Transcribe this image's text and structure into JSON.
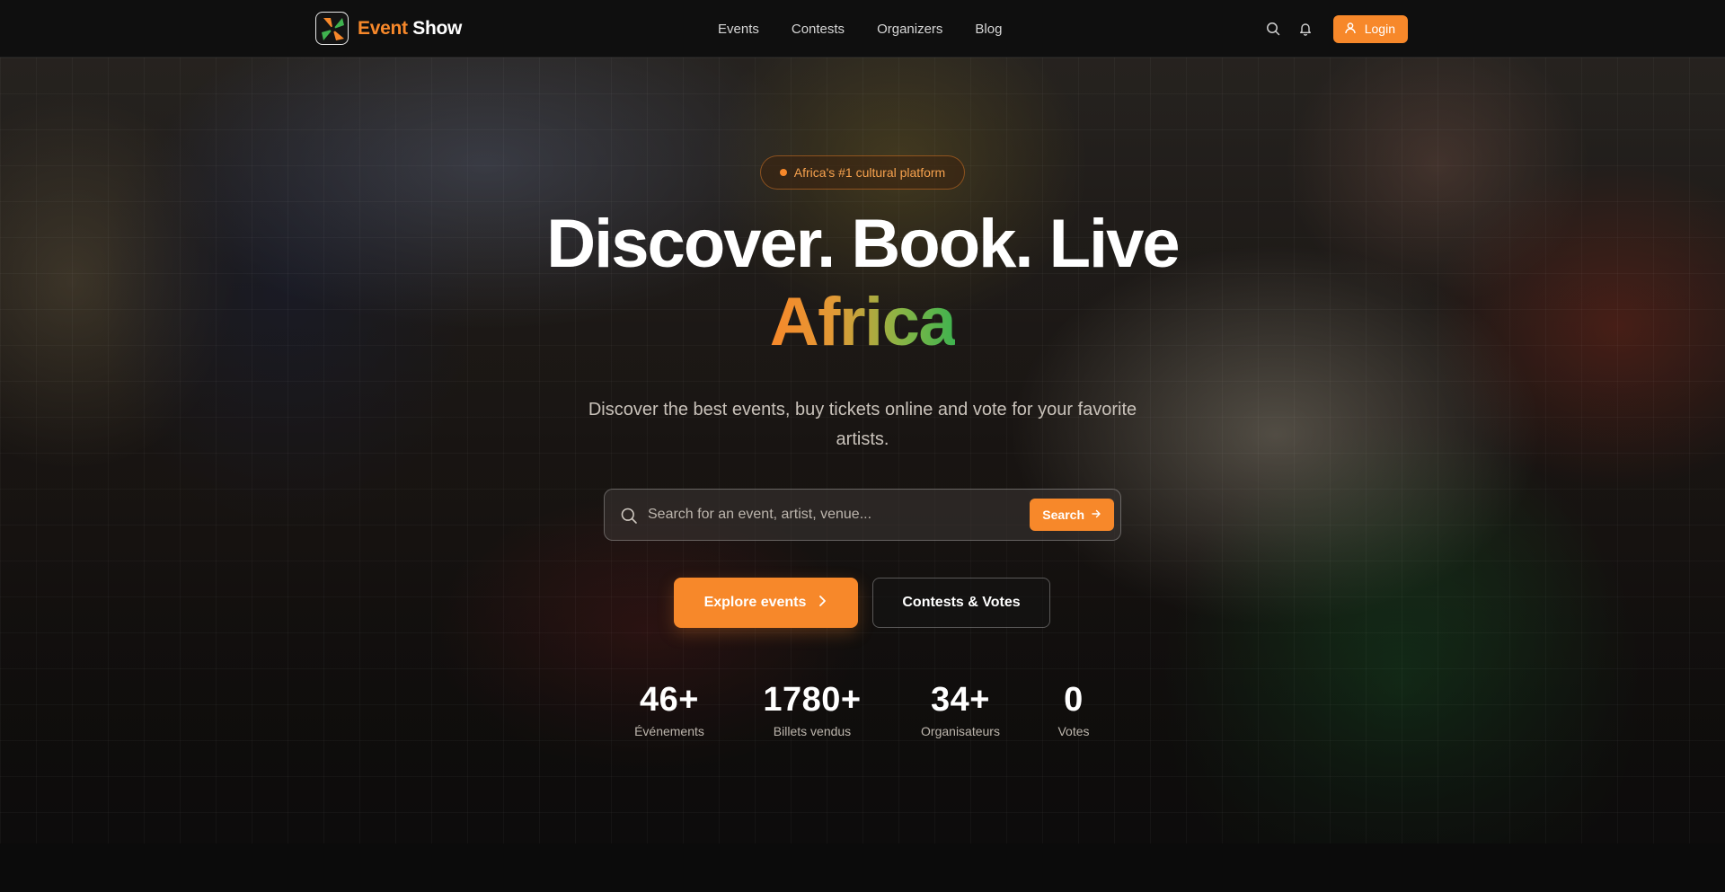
{
  "brand": {
    "name_part1": "Event",
    "name_part2": "Show",
    "accent_color": "#f7882a"
  },
  "nav": {
    "links": [
      "Events",
      "Contests",
      "Organizers",
      "Blog"
    ],
    "login_label": "Login",
    "icons": [
      "search-icon",
      "bell-icon",
      "user-icon"
    ]
  },
  "hero": {
    "badge": "Africa's #1 cultural platform",
    "headline": "Discover. Book. Live",
    "headline_accent": "Africa",
    "subtitle": "Discover the best events, buy tickets online and vote for your favorite artists.",
    "search": {
      "placeholder": "Search for an event, artist, venue...",
      "value": "",
      "button_label": "Search"
    },
    "cta_primary": "Explore events",
    "cta_secondary": "Contests & Votes"
  },
  "stats": [
    {
      "value": "46+",
      "label": "Événements"
    },
    {
      "value": "1780+",
      "label": "Billets vendus"
    },
    {
      "value": "34+",
      "label": "Organisateurs"
    },
    {
      "value": "0",
      "label": "Votes"
    }
  ]
}
